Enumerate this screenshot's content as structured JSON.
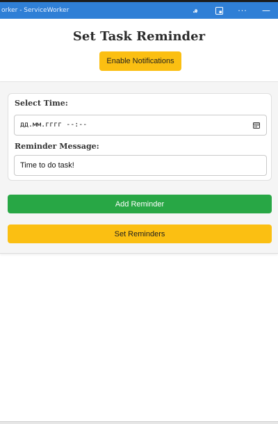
{
  "window": {
    "title": "orker - ServiceWorker",
    "titlebar_color": "#2f7fd6",
    "icons": [
      "read-aloud-icon",
      "app-available-icon",
      "more-options-icon",
      "minimize-icon"
    ],
    "read_aloud_glyph": "ꭿ",
    "more_glyph": "···",
    "minimize_glyph": "—"
  },
  "page": {
    "title": "Set Task Reminder",
    "enable_notifications_label": "Enable Notifications"
  },
  "form": {
    "time_label": "Select Time:",
    "time_placeholder": "дд.мм.гггг --:--",
    "message_label": "Reminder Message:",
    "message_value": "Time to do task!"
  },
  "buttons": {
    "add_reminder_label": "Add Reminder",
    "set_reminders_label": "Set Reminders"
  },
  "colors": {
    "accent_yellow": "#fbbf12",
    "accent_green": "#28a745"
  }
}
